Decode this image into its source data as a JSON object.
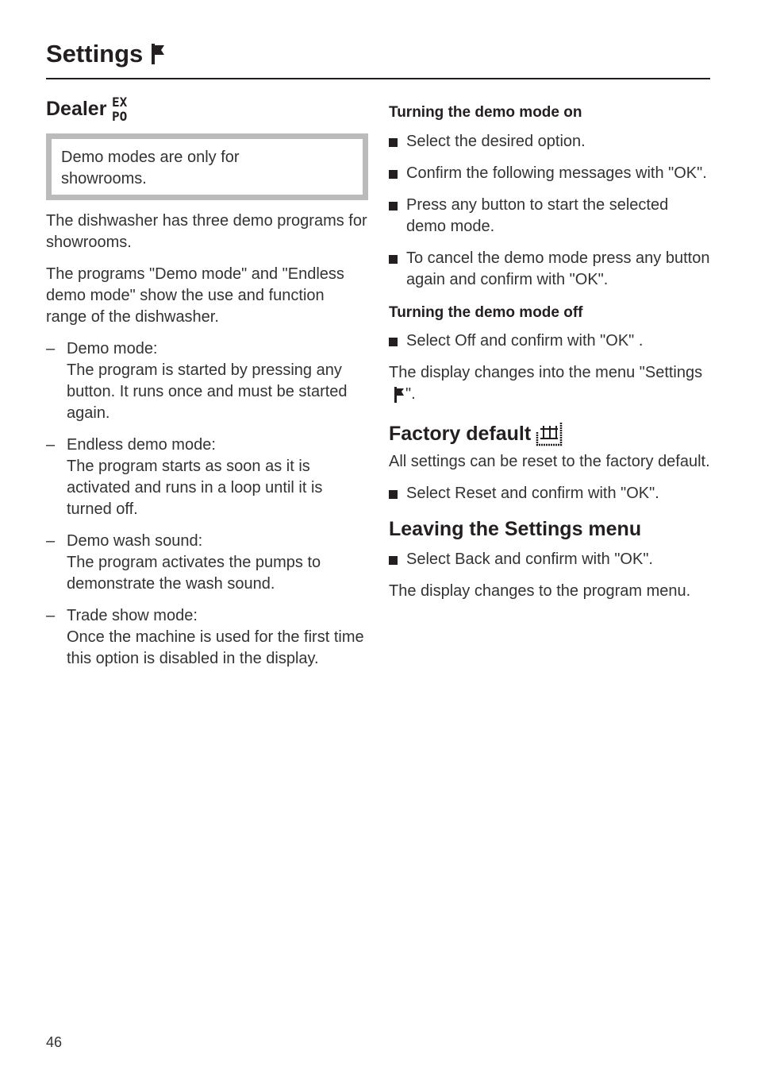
{
  "header": {
    "title": "Settings",
    "icon": "flag-icon"
  },
  "left": {
    "dealer_heading": "Dealer",
    "dealer_icon": "expo-icon",
    "note": "Demo modes are  only for showrooms.",
    "intro1": "The dishwasher has three demo programs for showrooms.",
    "intro2": "The programs \"Demo mode\" and \"Endless demo mode\" show the use and function range of the dishwasher.",
    "modes": [
      {
        "name": "Demo mode:",
        "desc": "The program is started by pressing any button. It runs once and must be started again."
      },
      {
        "name": "Endless demo mode:",
        "desc": "The program starts as soon as it is activated and runs in a loop until it is turned off."
      },
      {
        "name": "Demo wash sound:",
        "desc": "The program activates the pumps to demonstrate the wash sound."
      },
      {
        "name": "Trade show mode:",
        "desc": "Once the machine is used for the first time this option is disabled in the display."
      }
    ]
  },
  "right": {
    "demo_on_heading": "Turning the demo mode on",
    "demo_on_steps": [
      "Select the desired option.",
      "Confirm the following messages with \"OK\".",
      "Press any button to start the selected demo mode.",
      "To cancel the demo mode press any button again and confirm with \"OK\"."
    ],
    "demo_off_heading": "Turning the demo mode off",
    "demo_off_steps": [
      "Select Off and confirm with \"OK\" ."
    ],
    "demo_off_result_prefix": "The display changes into the menu \"Settings ",
    "demo_off_result_suffix": "\".",
    "factory_heading": "Factory default",
    "factory_icon": "factory-icon",
    "factory_text": "All settings can be reset to the factory default.",
    "factory_steps": [
      "Select Reset and confirm with \"OK\"."
    ],
    "leaving_heading": "Leaving the Settings menu",
    "leaving_steps": [
      "Select Back and confirm with \"OK\"."
    ],
    "leaving_result": "The display changes to the program menu."
  },
  "footer": {
    "page_number": "46"
  }
}
